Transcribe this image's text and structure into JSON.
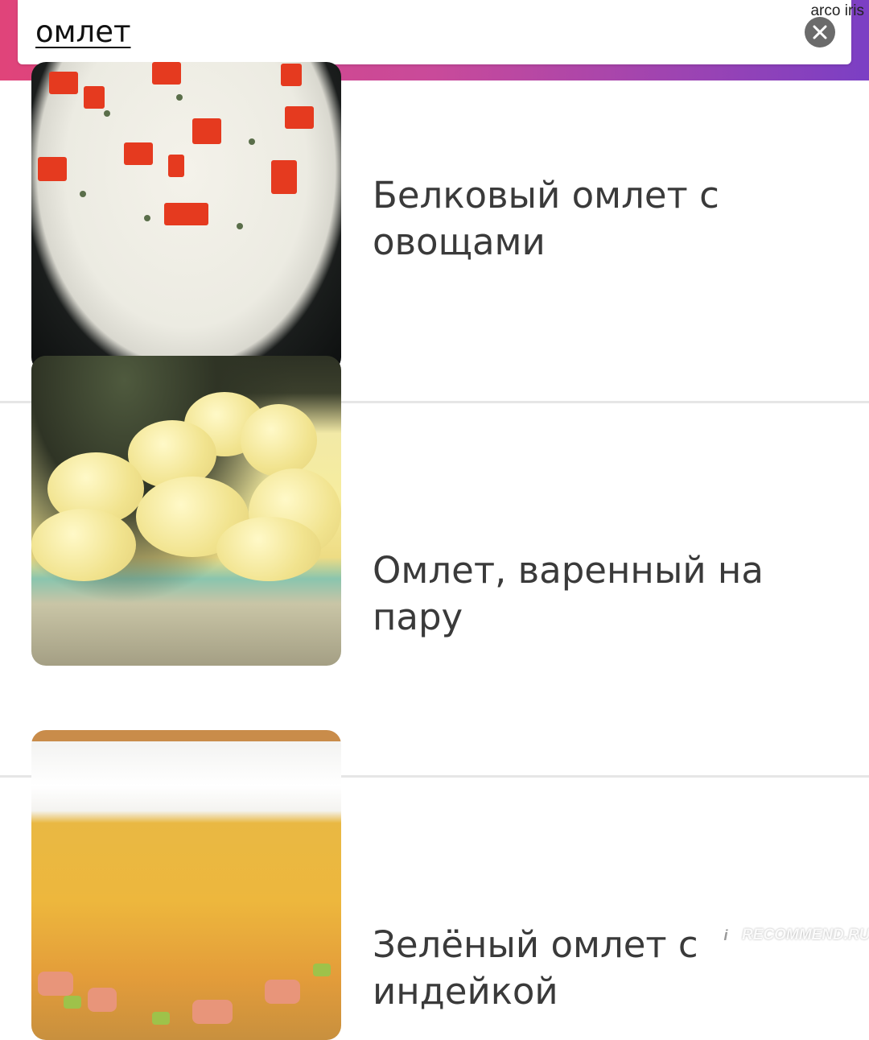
{
  "search": {
    "query": "омлет",
    "clear_icon": "close-icon"
  },
  "watermark_top": "arco iris",
  "results": [
    {
      "title": "Белковый омлет с овощами"
    },
    {
      "title": "Омлет, варенный на пару"
    },
    {
      "title": "Зелёный омлет с индейкой"
    }
  ],
  "watermark_bottom": "RECOMMEND.RU",
  "colors": {
    "header_gradient_start": "#e0447a",
    "header_gradient_end": "#7b3fc4",
    "title_text": "#3a3a3a",
    "divider": "#e6e6e6"
  }
}
